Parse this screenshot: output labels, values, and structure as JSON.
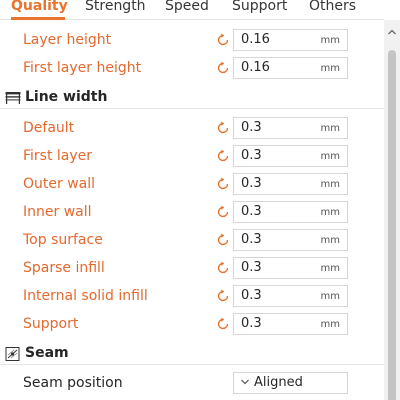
{
  "tabs": [
    {
      "label": "Quality",
      "active": true
    },
    {
      "label": "Strength",
      "active": false
    },
    {
      "label": "Speed",
      "active": false
    },
    {
      "label": "Support",
      "active": false
    },
    {
      "label": "Others",
      "active": false
    }
  ],
  "layer": {
    "layer_height": {
      "label": "Layer height",
      "value": "0.16",
      "unit": "mm"
    },
    "first_layer_height": {
      "label": "First layer height",
      "value": "0.16",
      "unit": "mm"
    }
  },
  "line_width": {
    "title": "Line width",
    "icon": "line-width-icon",
    "items": [
      {
        "label": "Default",
        "value": "0.3",
        "unit": "mm"
      },
      {
        "label": "First layer",
        "value": "0.3",
        "unit": "mm"
      },
      {
        "label": "Outer wall",
        "value": "0.3",
        "unit": "mm"
      },
      {
        "label": "Inner wall",
        "value": "0.3",
        "unit": "mm"
      },
      {
        "label": "Top surface",
        "value": "0.3",
        "unit": "mm"
      },
      {
        "label": "Sparse infill",
        "value": "0.3",
        "unit": "mm"
      },
      {
        "label": "Internal solid infill",
        "value": "0.3",
        "unit": "mm"
      },
      {
        "label": "Support",
        "value": "0.3",
        "unit": "mm"
      }
    ]
  },
  "seam": {
    "title": "Seam",
    "icon": "seam-icon",
    "position_label": "Seam position",
    "position_value": "Aligned"
  },
  "colors": {
    "accent": "#e8742d",
    "modified_label": "#e3692f",
    "reset_icon": "#e8742d"
  }
}
